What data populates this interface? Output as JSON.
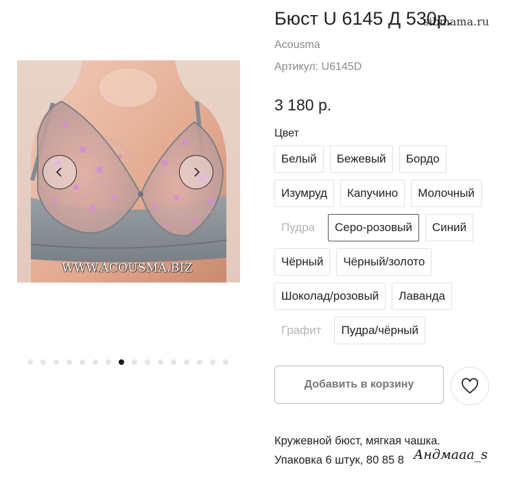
{
  "product": {
    "title": "Бюст U 6145 Д 530р.",
    "brand": "Acousma",
    "sku": "Артикул: U6145D",
    "price": "3 180 р.",
    "color_label": "Цвет",
    "colors": [
      {
        "label": "Белый",
        "state": "available"
      },
      {
        "label": "Бежевый",
        "state": "available"
      },
      {
        "label": "Бордо",
        "state": "available"
      },
      {
        "label": "Изумруд",
        "state": "available"
      },
      {
        "label": "Капучино",
        "state": "available"
      },
      {
        "label": "Молочный",
        "state": "available"
      },
      {
        "label": "Пудра",
        "state": "disabled"
      },
      {
        "label": "Серо-розовый",
        "state": "selected"
      },
      {
        "label": "Синий",
        "state": "available"
      },
      {
        "label": "Чёрный",
        "state": "available"
      },
      {
        "label": "Чёрный/золото",
        "state": "available"
      },
      {
        "label": "Шоколад/розовый",
        "state": "available"
      },
      {
        "label": "Лаванда",
        "state": "available"
      },
      {
        "label": "Графит",
        "state": "disabled"
      },
      {
        "label": "Пудра/чёрный",
        "state": "available"
      }
    ],
    "add_to_cart_label": "Добавить в корзину",
    "description_line1": "Кружевной бюст, мягкая чашка.",
    "description_line2": "Упаковка 6 штук, 80 85 8"
  },
  "gallery": {
    "image_watermark": "WWW.ACOUSMA.BIZ",
    "slide_count": 16,
    "active_slide": 8
  },
  "watermarks": {
    "top": "sibmama.ru",
    "bottom": "Андмааа_s"
  },
  "icons": {
    "prev": "chevron-left-icon",
    "next": "chevron-right-icon",
    "wishlist": "heart-icon"
  },
  "colors": {
    "dot_active": "#1a1a1a",
    "dot_inactive": "#e6e6e6",
    "disabled_text": "#b5b5b5",
    "button_text": "#777777"
  }
}
